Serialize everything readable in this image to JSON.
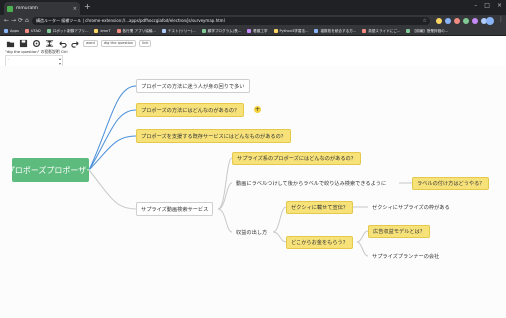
{
  "browser": {
    "tab_title": "mmurahh",
    "tab_close": "×",
    "new_tab": "+",
    "window_controls": [
      "–",
      "□",
      "×"
    ],
    "url": "構造ルーター 候補ツール | chrome-extension://...apps/pdfhoccgiafod/electron/js/surveymap.html",
    "nav": {
      "back": "←",
      "forward": "→",
      "reload": "⟳",
      "home": "⌂"
    },
    "bookmarks": [
      {
        "label": "Apps",
        "color": "#8ab4f8"
      },
      {
        "label": "UTAD",
        "color": "#f28b82"
      },
      {
        "label": "ロボット制御アプリ...",
        "color": "#81c995"
      },
      {
        "label": "kmnT",
        "color": "#fdd663"
      },
      {
        "label": "各行業 アプリ協議...",
        "color": "#f28b82"
      },
      {
        "label": "テスト(ツリー)...",
        "color": "#aecbfa"
      },
      {
        "label": "顧学プログラム(長...",
        "color": "#81c995"
      },
      {
        "label": "看護工学",
        "color": "#c58af9"
      },
      {
        "label": "Python3学習法...",
        "color": "#fdd663"
      },
      {
        "label": "複数枚を統合する方...",
        "color": "#8ab4f8"
      },
      {
        "label": "英語スライドにご...",
        "color": "#f28b82"
      },
      {
        "label": "【前編】授業評価の...",
        "color": "#81c995"
      }
    ]
  },
  "toolbar": {
    "tool_icons": [
      "folder-icon",
      "save-icon",
      "gear-icon",
      "expand-icon",
      "undo-icon",
      "redo-icon"
    ],
    "chip1": "word",
    "chip2": "dig the question",
    "chip3": "link",
    "second_row": "\"dig the question\" の投影説明",
    "second_row_extra": "Ctrl",
    "prop_box_text": "-"
  },
  "mindmap": {
    "root": "プロポーズプロポーザー",
    "n1": "プロポーズの方法に迷う人が身の回りで多い",
    "n2": "プロポーズの方法にはどんなのがあるの？",
    "n3": "プロポーズを支援する既存サービスにはどんなものがあるの？",
    "n4": "サプライズ動画検索サービス",
    "n5": "サプライズ系のプロポーズにはどんなのがあるの？",
    "n6": "動画にラベルつけして後からラベルで絞り込み検索できるように",
    "n7": "ラベルの付け方はどうやる？",
    "n8": "収益の出し方",
    "n9": "ゼクシィに載せて宣伝？",
    "n10": "ゼクシィにサプライズの枠がある",
    "n11": "どこからお金をもらう？",
    "n12": "広告収益モデルとは？",
    "n13": "サプライズプランナーの会社",
    "plus": "+",
    "colors": {
      "root": "#5dbb7e",
      "question": "#f7e27a",
      "edge_blue": "#4a90d9",
      "edge_gray": "#c8c8c8"
    }
  }
}
